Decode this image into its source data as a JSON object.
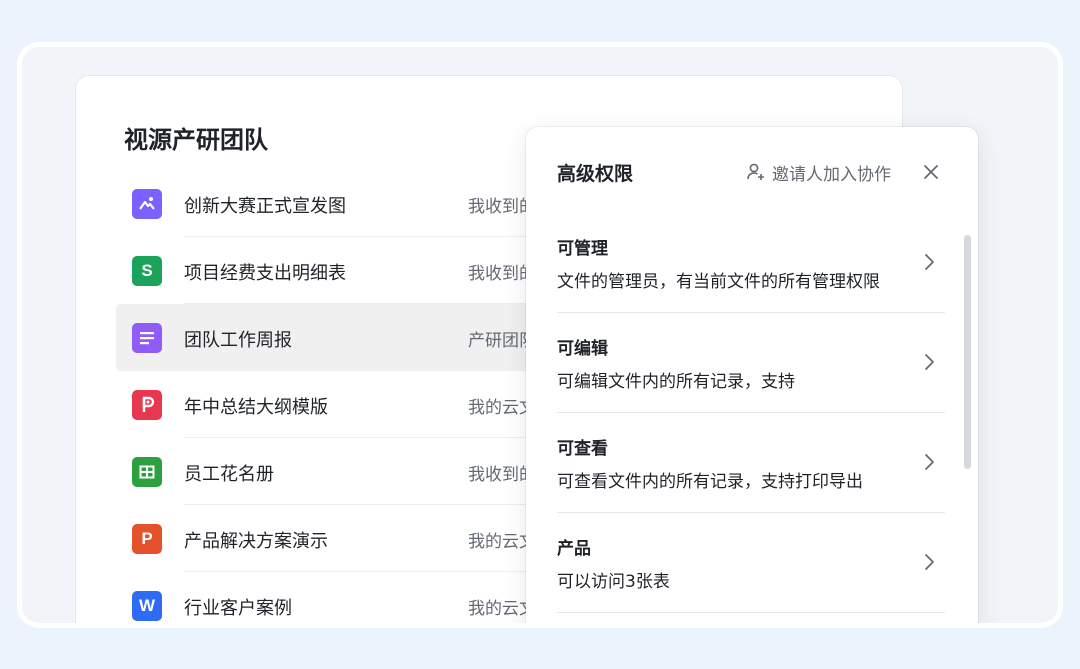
{
  "team": {
    "title": "视源产研团队"
  },
  "files": [
    {
      "name": "创新大赛正式宣发图",
      "location": "我收到的",
      "icon": "image-icon",
      "color": "#7b61ff",
      "glyph": ""
    },
    {
      "name": "项目经费支出明细表",
      "location": "我收到的",
      "icon": "sheet-icon",
      "color": "#1aa35a",
      "glyph": "S"
    },
    {
      "name": "团队工作周报",
      "location": "产研团队",
      "icon": "doc-icon",
      "color": "#8f5cf5",
      "glyph": ""
    },
    {
      "name": "年中总结大纲模版",
      "location": "我的云文",
      "icon": "mindmap-icon",
      "color": "#e8384f",
      "glyph": ""
    },
    {
      "name": "员工花名册",
      "location": "我收到的",
      "icon": "table-icon",
      "color": "#2e9f3e",
      "glyph": ""
    },
    {
      "name": "产品解决方案演示",
      "location": "我的云文",
      "icon": "slides-icon",
      "color": "#e5512b",
      "glyph": "P"
    },
    {
      "name": "行业客户案例",
      "location": "我的云文",
      "icon": "word-icon",
      "color": "#2f6cf6",
      "glyph": "W"
    }
  ],
  "panel": {
    "title": "高级权限",
    "invite_label": "邀请人加入协作",
    "items": [
      {
        "title": "可管理",
        "desc": "文件的管理员，有当前文件的所有管理权限"
      },
      {
        "title": "可编辑",
        "desc": "可编辑文件内的所有记录，支持"
      },
      {
        "title": "可查看",
        "desc": "可查看文件内的所有记录，支持打印导出"
      },
      {
        "title": "产品",
        "desc": "可以访问3张表"
      }
    ]
  }
}
